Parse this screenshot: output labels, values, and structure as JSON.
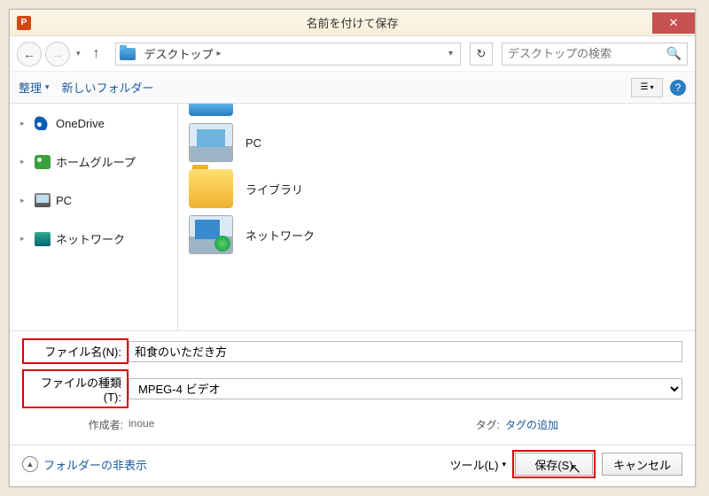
{
  "title": "名前を付けて保存",
  "app_icon_letter": "P",
  "nav": {
    "path_seg": "デスクトップ",
    "search_placeholder": "デスクトップの検索"
  },
  "toolbar": {
    "organize": "整理",
    "newfolder": "新しいフォルダー"
  },
  "sidebar": {
    "items": [
      {
        "label": "OneDrive"
      },
      {
        "label": "ホームグループ"
      },
      {
        "label": "PC"
      },
      {
        "label": "ネットワーク"
      }
    ]
  },
  "files": {
    "items": [
      {
        "label": "PC"
      },
      {
        "label": "ライブラリ"
      },
      {
        "label": "ネットワーク"
      }
    ]
  },
  "form": {
    "filename_label": "ファイル名(N):",
    "filename_value": "和食のいただき方",
    "filetype_label": "ファイルの種類(T):",
    "filetype_value": "MPEG-4 ビデオ",
    "author_label": "作成者:",
    "author_value": "inoue",
    "tag_label": "タグ:",
    "tag_value": "タグの追加"
  },
  "footer": {
    "hide_folders": "フォルダーの非表示",
    "tools": "ツール(L)",
    "save": "保存(S)",
    "cancel": "キャンセル"
  }
}
